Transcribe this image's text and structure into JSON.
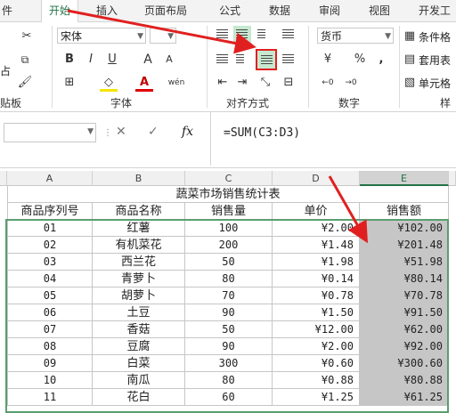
{
  "tabs": [
    "件",
    "开始",
    "插入",
    "页面布局",
    "公式",
    "数据",
    "审阅",
    "视图",
    "开发工"
  ],
  "font": {
    "name": "宋体",
    "bold": "B",
    "italic": "I",
    "underline": "U",
    "grow": "A",
    "shrink": "A",
    "pinyin": "wén",
    "font_color": "A"
  },
  "clipboard": {
    "cut": "✂",
    "paste_fragment": "占",
    "label": "贴板"
  },
  "groups": {
    "font": "字体",
    "align": "对齐方式",
    "number": "数字",
    "styles": "样"
  },
  "number": {
    "format": "货币",
    "currency_symbol": "¥",
    "percent": "%",
    "comma": ","
  },
  "styles": {
    "conditional": "条件格",
    "table": "套用表",
    "cell": "单元格"
  },
  "formula_bar": {
    "formula": "=SUM(C3:D3)",
    "cancel": "✕",
    "enter": "✓",
    "fx": "fx"
  },
  "columns": [
    "A",
    "B",
    "C",
    "D",
    "E"
  ],
  "sheet_title": "蔬菜市场销售统计表",
  "headers": [
    "商品序列号",
    "商品名称",
    "销售量",
    "单价",
    "销售额"
  ],
  "rows": [
    [
      "01",
      "红薯",
      "100",
      "¥2.00",
      "¥102.00"
    ],
    [
      "02",
      "有机菜花",
      "200",
      "¥1.48",
      "¥201.48"
    ],
    [
      "03",
      "西兰花",
      "50",
      "¥1.98",
      "¥51.98"
    ],
    [
      "04",
      "青萝卜",
      "80",
      "¥0.14",
      "¥80.14"
    ],
    [
      "05",
      "胡萝卜",
      "70",
      "¥0.78",
      "¥70.78"
    ],
    [
      "06",
      "土豆",
      "90",
      "¥1.50",
      "¥91.50"
    ],
    [
      "07",
      "香菇",
      "50",
      "¥12.00",
      "¥62.00"
    ],
    [
      "08",
      "豆腐",
      "90",
      "¥2.00",
      "¥92.00"
    ],
    [
      "09",
      "白菜",
      "300",
      "¥0.60",
      "¥300.60"
    ],
    [
      "10",
      "南瓜",
      "80",
      "¥0.88",
      "¥80.88"
    ],
    [
      "11",
      "花白",
      "60",
      "¥1.25",
      "¥61.25"
    ]
  ]
}
